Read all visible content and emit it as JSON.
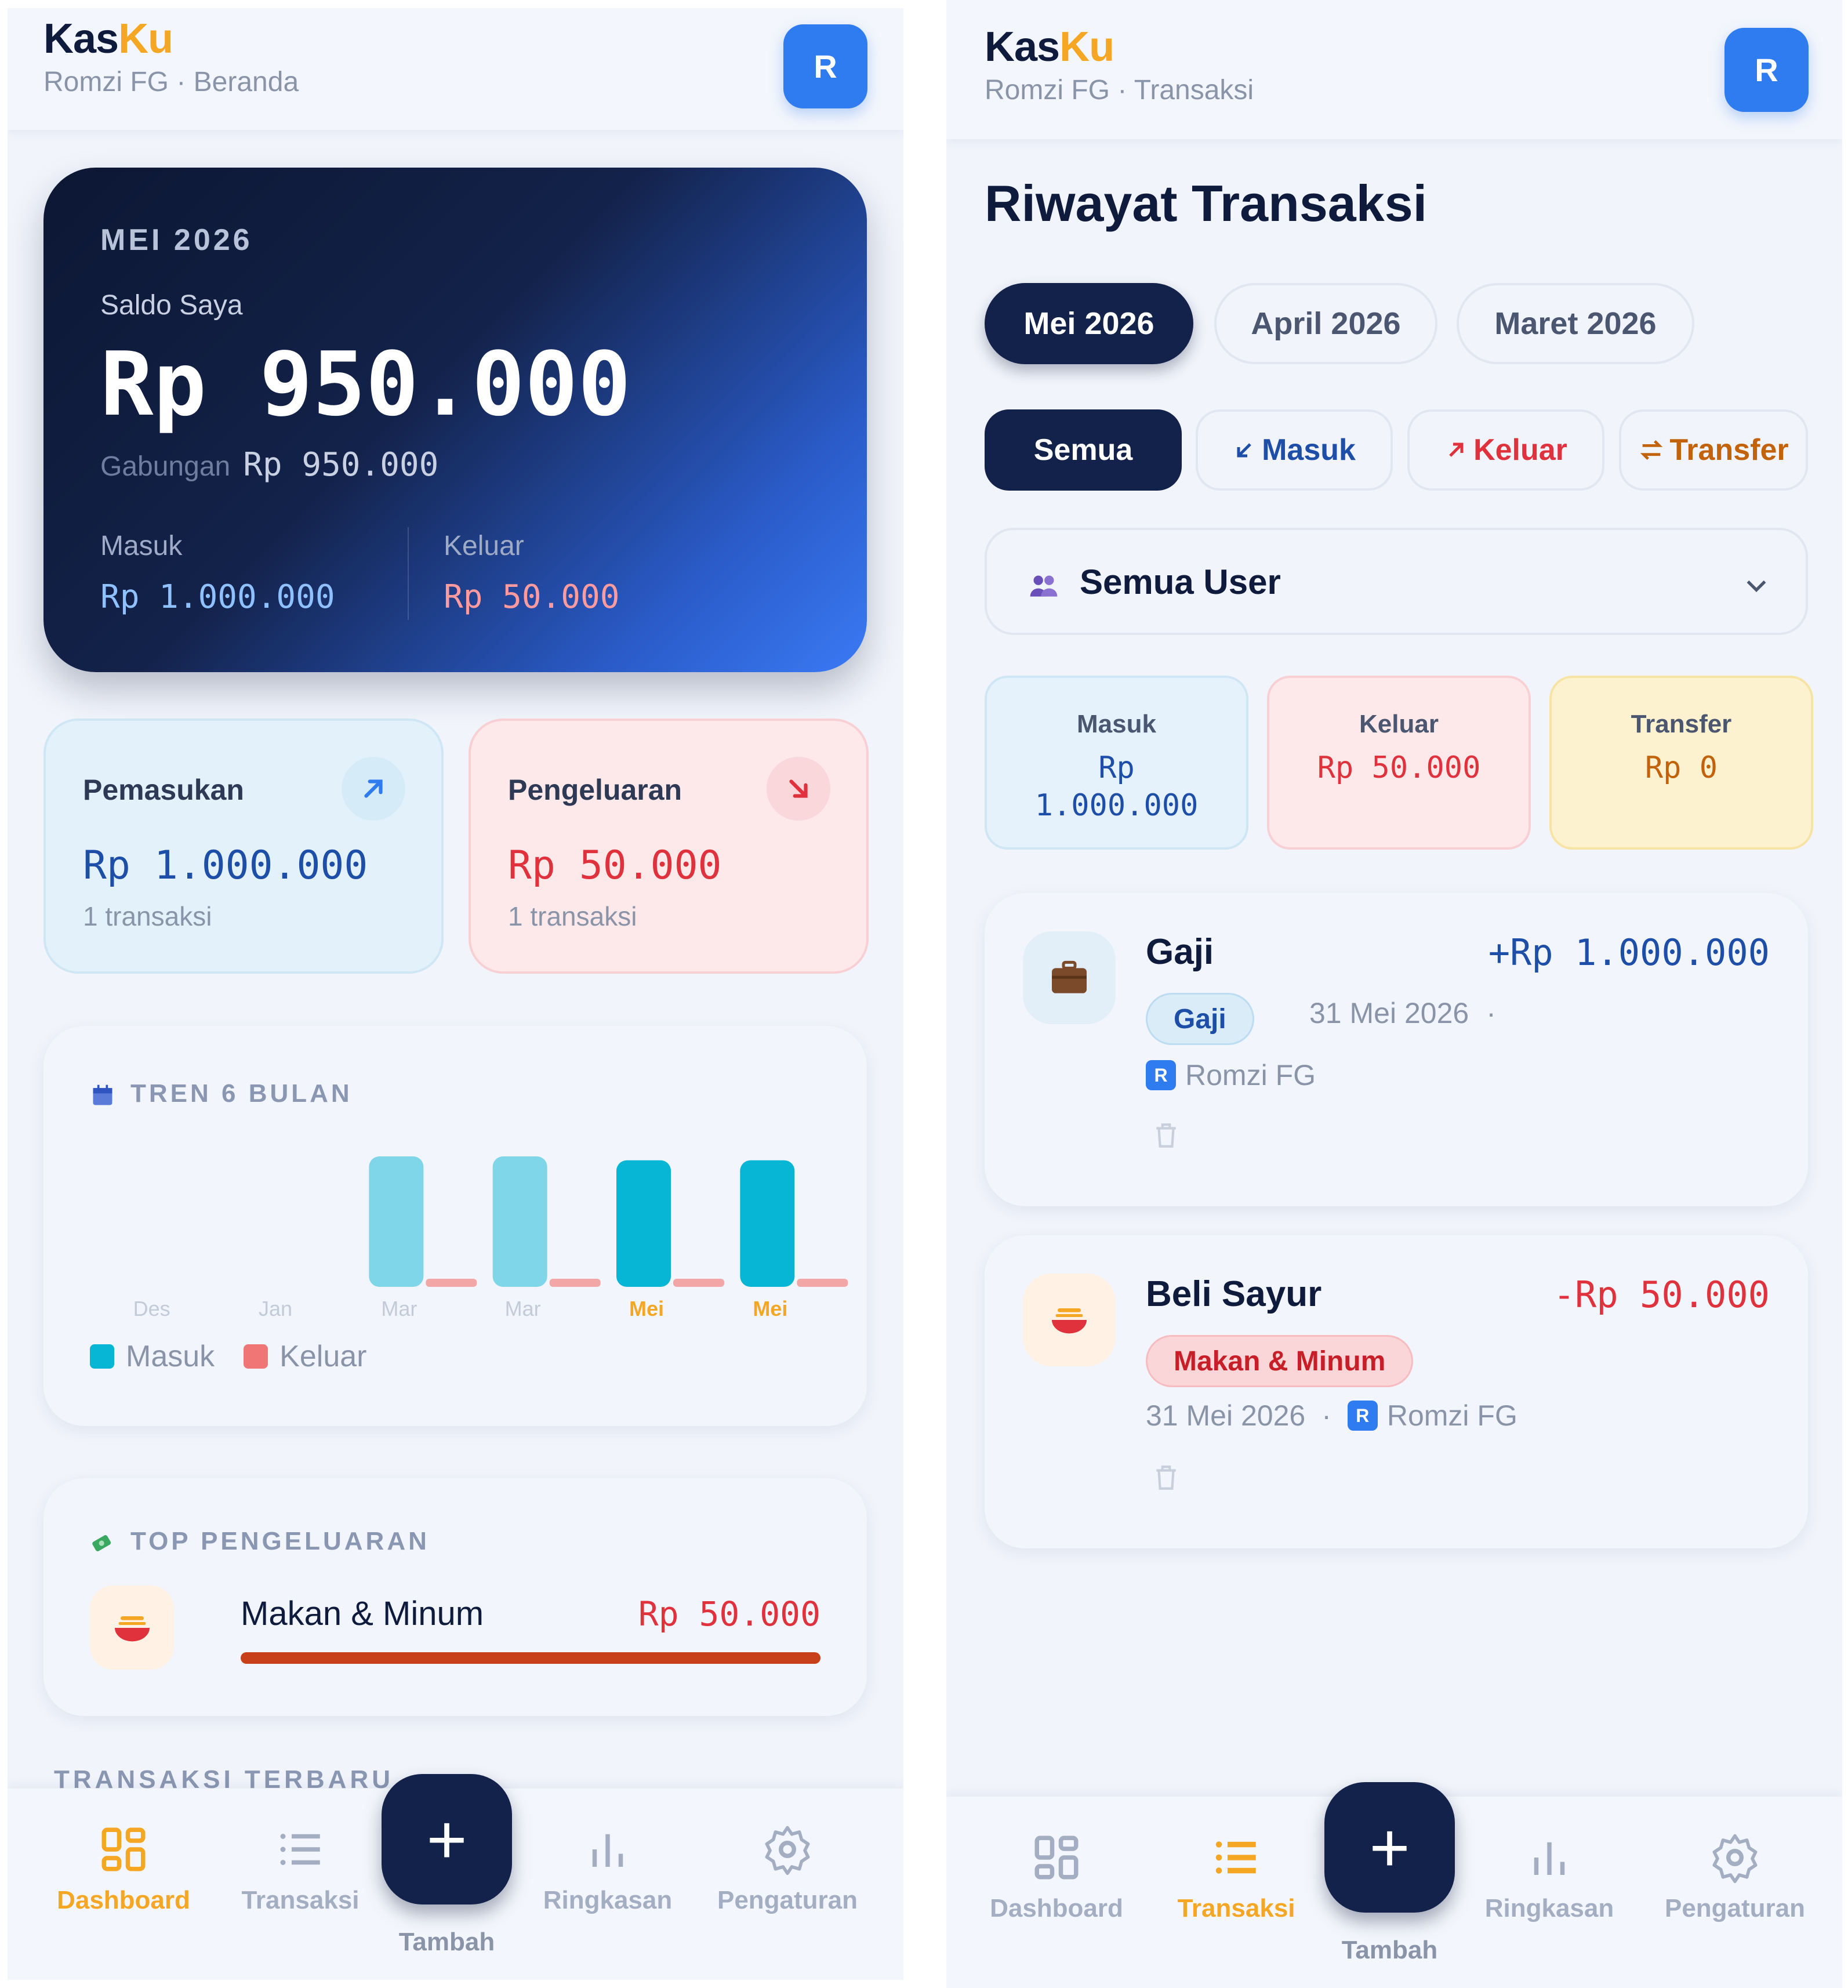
{
  "app": {
    "logo_a": "Kas",
    "logo_b": "Ku",
    "avatar": "R"
  },
  "dashboard": {
    "subtitle": "Romzi FG · Beranda",
    "balance": {
      "month": "MEI 2026",
      "label": "Saldo Saya",
      "amount": "Rp 950.000",
      "combined_label": "Gabungan",
      "combined_value": "Rp 950.000",
      "in_label": "Masuk",
      "in_value": "Rp 1.000.000",
      "out_label": "Keluar",
      "out_value": "Rp 50.000"
    },
    "income": {
      "title": "Pemasukan",
      "value": "Rp 1.000.000",
      "count": "1 transaksi"
    },
    "expense": {
      "title": "Pengeluaran",
      "value": "Rp 50.000",
      "count": "1 transaksi"
    },
    "trend": {
      "title": "TREN 6 BULAN",
      "legend_in": "Masuk",
      "legend_out": "Keluar"
    },
    "top_spending": {
      "title": "TOP PENGELUARAN",
      "item_name": "Makan & Minum",
      "item_value": "Rp 50.000",
      "item_share": 1.0
    },
    "recent_title": "TRANSAKSI TERBARU"
  },
  "chart_data": {
    "type": "bar",
    "title": "TREN 6 BULAN",
    "categories": [
      "Des",
      "Jan",
      "Mar",
      "Mar",
      "Mei",
      "Mei"
    ],
    "highlight_categories": [
      4,
      5
    ],
    "series": [
      {
        "name": "Masuk",
        "color": "#7ed6e8",
        "highlight_color": "#06b6d4",
        "values": [
          0,
          0,
          1000000,
          1000000,
          970000,
          970000
        ]
      },
      {
        "name": "Keluar",
        "color": "#f3a6a6",
        "values": [
          0,
          0,
          50000,
          50000,
          50000,
          50000
        ]
      }
    ],
    "ylim": [
      0,
      1000000
    ],
    "grid": false,
    "legend": "bottom-left"
  },
  "transactions": {
    "subtitle": "Romzi FG · Transaksi",
    "page_title": "Riwayat Transaksi",
    "months": [
      "Mei 2026",
      "April 2026",
      "Maret 2026"
    ],
    "filters": {
      "all": "Semua",
      "in": "Masuk",
      "out": "Keluar",
      "transfer": "Transfer"
    },
    "user_select": "Semua User",
    "summary": {
      "in_label": "Masuk",
      "in_value_a": "Rp",
      "in_value_b": "1.000.000",
      "out_label": "Keluar",
      "out_value": "Rp 50.000",
      "tr_label": "Transfer",
      "tr_value": "Rp 0"
    },
    "items": [
      {
        "title": "Gaji",
        "amount": "+Rp 1.000.000",
        "category": "Gaji",
        "date": "31 Mei 2026",
        "sep": "·",
        "user": "Romzi FG",
        "user_badge": "R"
      },
      {
        "title": "Beli Sayur",
        "amount": "-Rp 50.000",
        "category": "Makan & Minum",
        "date": "31 Mei 2026",
        "sep": "·",
        "user": "Romzi FG",
        "user_badge": "R"
      }
    ]
  },
  "nav": {
    "dashboard": "Dashboard",
    "transactions": "Transaksi",
    "add": "Tambah",
    "summary": "Ringkasan",
    "settings": "Pengaturan",
    "active_color": "#f5a623"
  }
}
